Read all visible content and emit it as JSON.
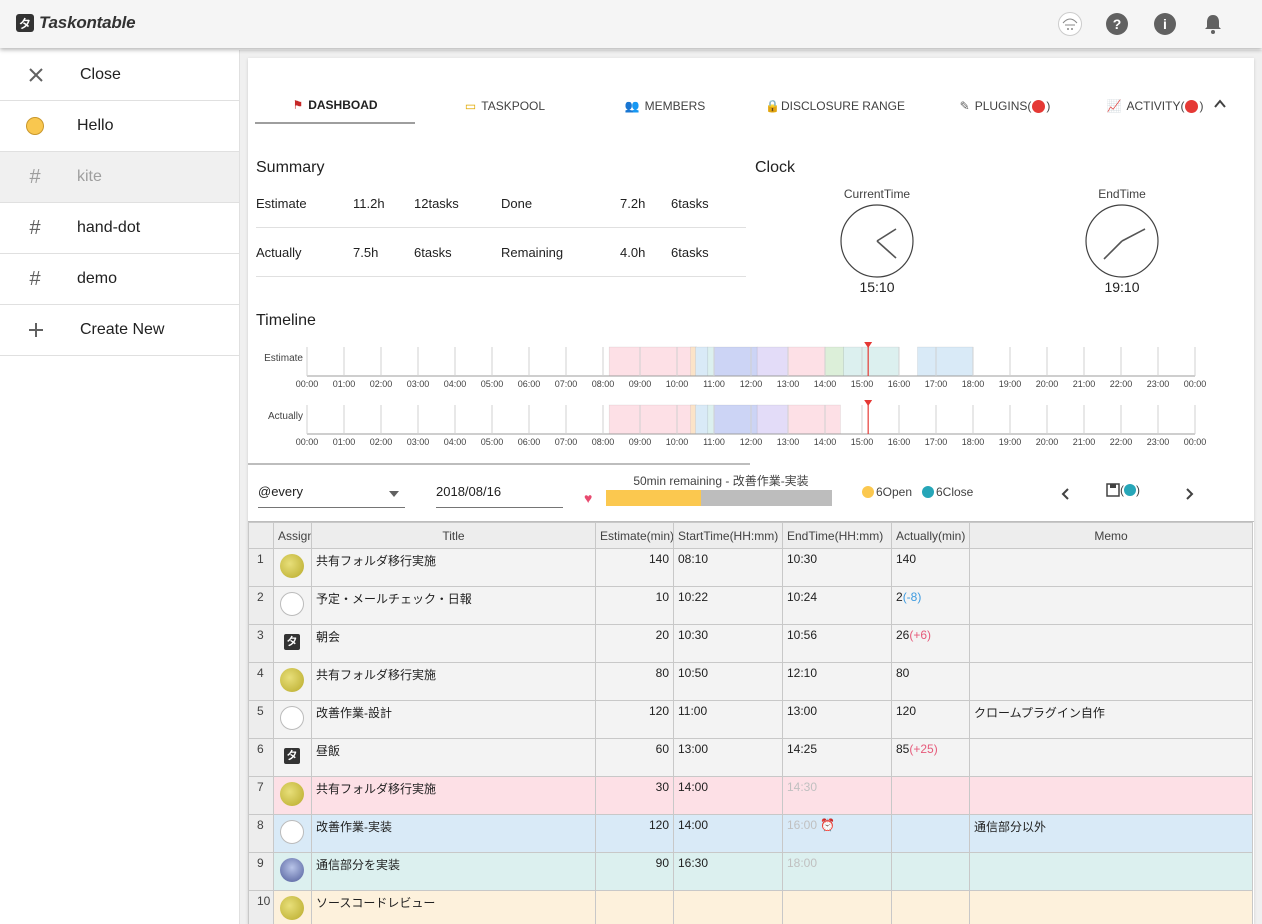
{
  "app": {
    "title": "Taskontable",
    "logo_glyph": "タ"
  },
  "header_icons": [
    "avatar",
    "help-icon",
    "info-icon",
    "bell-icon"
  ],
  "sidebar": {
    "items": [
      {
        "label": "Close",
        "icon": "close-icon"
      },
      {
        "label": "Hello",
        "icon": "emoji-icon"
      },
      {
        "label": "kite",
        "icon": "hash-icon",
        "active": true
      },
      {
        "label": "hand-dot",
        "icon": "hash-icon"
      },
      {
        "label": "demo",
        "icon": "hash-icon"
      },
      {
        "label": "Create New",
        "icon": "plus-icon"
      }
    ]
  },
  "tabs": [
    {
      "label": "DASHBOAD",
      "icon": "flag-icon",
      "selected": true
    },
    {
      "label": "TASKPOOL",
      "icon": "folder-icon"
    },
    {
      "label": "MEMBERS",
      "icon": "members-icon"
    },
    {
      "label": "DISCLOSURE RANGE",
      "icon": "lock-icon"
    },
    {
      "label": "PLUGINS(",
      "icon": "plug-icon",
      "badge": ")"
    },
    {
      "label": "ACTIVITY(",
      "icon": "chart-icon",
      "badge": ")"
    }
  ],
  "summary": {
    "title": "Summary",
    "rows": [
      {
        "l1": "Estimate",
        "v1": "11.2h",
        "c1": "12tasks",
        "l2": "Done",
        "v2": "7.2h",
        "c2": "6tasks"
      },
      {
        "l1": "Actually",
        "v1": "7.5h",
        "c1": "6tasks",
        "l2": "Remaining",
        "v2": "4.0h",
        "c2": "6tasks"
      }
    ]
  },
  "clock": {
    "title": "Clock",
    "current": {
      "label": "CurrentTime",
      "time": "15:10"
    },
    "end": {
      "label": "EndTime",
      "time": "19:10"
    }
  },
  "timeline": {
    "title": "Timeline",
    "estimate_label": "Estimate",
    "actually_label": "Actually",
    "hours": [
      "00:00",
      "01:00",
      "02:00",
      "03:00",
      "04:00",
      "05:00",
      "06:00",
      "07:00",
      "08:00",
      "09:00",
      "10:00",
      "11:00",
      "12:00",
      "13:00",
      "14:00",
      "15:00",
      "16:00",
      "17:00",
      "18:00",
      "19:00",
      "20:00",
      "21:00",
      "22:00",
      "23:00",
      "00:00"
    ],
    "now": "15:10",
    "estimate_blocks": [
      {
        "start": "08:10",
        "end": "10:30",
        "color": "#fde0e6"
      },
      {
        "start": "10:22",
        "end": "10:32",
        "color": "#fbe3c8"
      },
      {
        "start": "10:30",
        "end": "10:50",
        "color": "#d9eaf7"
      },
      {
        "start": "10:50",
        "end": "11:00",
        "color": "#dcf0ef"
      },
      {
        "start": "11:00",
        "end": "12:10",
        "color": "#ccd4f5"
      },
      {
        "start": "12:10",
        "end": "13:00",
        "color": "#e3dcf8"
      },
      {
        "start": "13:00",
        "end": "14:00",
        "color": "#fde0e6"
      },
      {
        "start": "14:00",
        "end": "14:30",
        "color": "#dcefd9"
      },
      {
        "start": "14:30",
        "end": "16:00",
        "color": "#dcf0ef"
      },
      {
        "start": "16:30",
        "end": "18:00",
        "color": "#d9eaf7"
      }
    ],
    "actual_blocks": [
      {
        "start": "08:10",
        "end": "10:30",
        "color": "#fde0e6"
      },
      {
        "start": "10:22",
        "end": "10:32",
        "color": "#fbe3c8"
      },
      {
        "start": "10:30",
        "end": "10:50",
        "color": "#d9eaf7"
      },
      {
        "start": "10:50",
        "end": "11:00",
        "color": "#dcf0ef"
      },
      {
        "start": "11:00",
        "end": "12:10",
        "color": "#ccd4f5"
      },
      {
        "start": "12:10",
        "end": "13:00",
        "color": "#e3dcf8"
      },
      {
        "start": "13:00",
        "end": "14:25",
        "color": "#fde0e6"
      }
    ]
  },
  "toolbar": {
    "select_value": "@every",
    "date_value": "2018/08/16",
    "progress_label": "50min remaining - 改善作業-実装",
    "progress_fraction": 0.42,
    "open_label": "6Open",
    "close_label": "6Close",
    "save_label": "(",
    "save_suffix": ")"
  },
  "table": {
    "columns": [
      "",
      "Assign",
      "Title",
      "Estimate(min)",
      "StartTime(HH:mm)",
      "EndTime(HH:mm)",
      "Actually(min)",
      "Memo"
    ],
    "rows": [
      {
        "idx": "1",
        "avatar": "gold",
        "title": "共有フォルダ移行実施",
        "est": "140",
        "start": "08:10",
        "end": "10:30",
        "act": "140",
        "diff": "",
        "memo": "",
        "color": "grey"
      },
      {
        "idx": "2",
        "avatar": "sketch",
        "title": "予定・メールチェック・日報",
        "est": "10",
        "start": "10:22",
        "end": "10:24",
        "act": "2",
        "diff": "(-8)",
        "memo": "",
        "color": "grey"
      },
      {
        "idx": "3",
        "avatar": "logo",
        "title": "朝会",
        "est": "20",
        "start": "10:30",
        "end": "10:56",
        "act": "26",
        "diff": "(+6)",
        "memo": "",
        "color": "grey"
      },
      {
        "idx": "4",
        "avatar": "gold",
        "title": "共有フォルダ移行実施",
        "est": "80",
        "start": "10:50",
        "end": "12:10",
        "act": "80",
        "diff": "",
        "memo": "",
        "color": "grey"
      },
      {
        "idx": "5",
        "avatar": "sketch",
        "title": "改善作業-設計",
        "est": "120",
        "start": "11:00",
        "end": "13:00",
        "act": "120",
        "diff": "",
        "memo": "クロームプラグイン自作",
        "color": "grey"
      },
      {
        "idx": "6",
        "avatar": "logo",
        "title": "昼飯",
        "est": "60",
        "start": "13:00",
        "end": "14:25",
        "act": "85",
        "diff": "(+25)",
        "memo": "",
        "color": "grey"
      },
      {
        "idx": "7",
        "avatar": "gold",
        "title": "共有フォルダ移行実施",
        "est": "30",
        "start": "14:00",
        "end": "14:30",
        "act": "",
        "diff": "",
        "memo": "",
        "color": "pink",
        "end_muted": true
      },
      {
        "idx": "8",
        "avatar": "sketch",
        "title": "改善作業-実装",
        "est": "120",
        "start": "14:00",
        "end": "16:00",
        "act": "",
        "diff": "",
        "memo": "通信部分以外",
        "color": "blue",
        "end_muted": true,
        "alarm": true
      },
      {
        "idx": "9",
        "avatar": "photo",
        "title": "通信部分を実装",
        "est": "90",
        "start": "16:30",
        "end": "18:00",
        "act": "",
        "diff": "",
        "memo": "",
        "color": "teal",
        "end_muted": true
      },
      {
        "idx": "10",
        "avatar": "gold",
        "title": "ソースコードレビュー",
        "est": "",
        "start": "",
        "end": "",
        "act": "",
        "diff": "",
        "memo": "",
        "color": "cream"
      }
    ]
  }
}
